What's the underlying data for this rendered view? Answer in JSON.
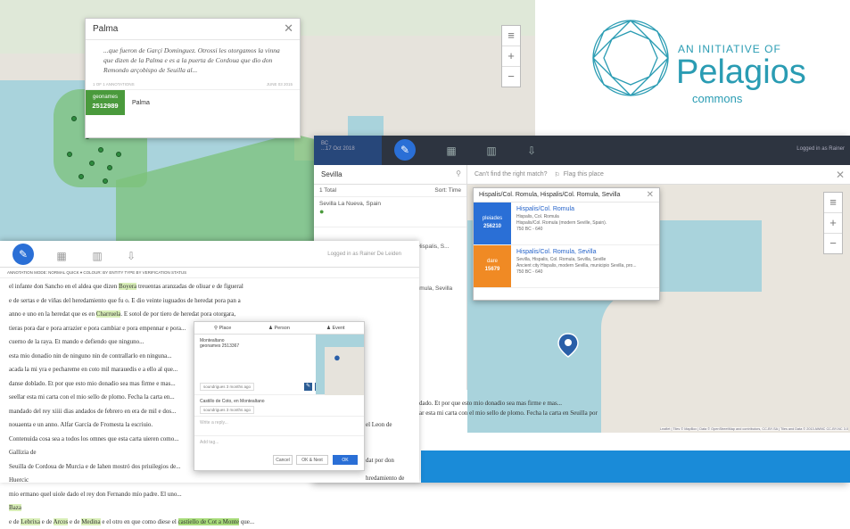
{
  "map1": {
    "zoom_in": "+",
    "zoom_out": "−",
    "layers": "≡"
  },
  "popup1": {
    "title": "Palma",
    "quote": "...que fueron de Garçi Dominguez. Otrossi les otorgamos la vinna que dizen de la Palma e es a la puerta de Cordoua que dio don Remondo arçobispo de Seuilla al...",
    "annotation_count": "1 OF 1 ANNOTATIONS",
    "date": "JUNE 03 2015",
    "gazetteer_name": "geonames",
    "gazetteer_id": "2512989",
    "place_name": "Palma"
  },
  "logo": {
    "line1": "AN INITIATIVE OF",
    "line2": "Pelagios",
    "line3": "commons"
  },
  "app2": {
    "header_left": "ВС",
    "header_left_sub": "...17 Oct 2018",
    "login": "Logged in as Rainer",
    "search_value": "Sevilla",
    "cant_find": "Can't find the right match?",
    "flag": "Flag this place",
    "results_count": "1 Total",
    "sort_label": "Sort: Time",
    "result1": "Sevilla La Nueva, Spain",
    "result_partial1": "...Hispalis, S...",
    "result_partial2": "Romula, Sevilla",
    "popup_title": "Hispalis/Col. Romula, Hispalis/Col. Romula, Sevilla",
    "entries": [
      {
        "gaz": "pleiades",
        "id": "256210",
        "name": "Hispalis/Col. Romula",
        "l1": "Hispalis, Col. Romula",
        "l2": "Hispalis/Col. Romula (modern Seville, Spain).",
        "l3": "750 BC - 640",
        "color": "#2a6fd6"
      },
      {
        "gaz": "dare",
        "id": "15679",
        "name": "Hispalis/Col. Romula, Sevilla",
        "l1": "Sevilla, Hispalis, Col. Romula, Sevilla, Seville",
        "l2": "Ancient city Hispalis, modern Sevilla, municipio Sevilla, pro...",
        "l3": "750 BC - 640",
        "color": "#f08a24"
      }
    ],
    "attribution": "Leaflet | Tiles © MapBox | Data © OpenStreetMap and contributors, CC-BY-SA | Tiles and Data © 2013 AWMC CC-BY-NC 3.0"
  },
  "app3": {
    "login": "Logged in as Rainer De Leiden",
    "modes": "ANNOTATION MODE: NORMAL  QUICK ▾  COLOUR: BY ENTITY TYPE  BY VERIFICATION STATUS",
    "lines": [
      "el infante don Sancho en el aldea que dizen Boyera treuentas aranzadas de oliuar e de figueral",
      "e de sertas e de viñas del heredamiento que fu o. E dio veinte iuguados de heredat pora pan a",
      "anno e uno en la heredat que es en Charruela. E sotol de por tiero de heredat pora otorgara,",
      "tieras pora dar e pora arrazier e pora cambiar e pora empennar e pora...",
      "cuerno de la raya. Et mando e defiendo que ninguno...",
      "esta mio donadio nin de ninguno nin de contrallarlo en ninguna...",
      "acada la mi yra e pechareme en coto mil marauedis e a ello al que...",
      "danse doblado. Et por que esto mio donadio sea mas firme e mas...",
      "seellar esta mi carta con el mio sello de plomo. Fecha la carta en...",
      "mandado del rey xiiii dias andados de febrero en era de mil e dos...",
      "nouaenta e un anno. Alfar García de Fromesta la escriuio.",
      "Contenuida cosa sea a todos los omnes que esta carta uieren como...",
      "Gallizia de",
      "Seuilla de Cordoua de Murcia e de Iahen mostró dos priuilegios de...",
      "Huercic",
      "mio ermano quel uiole dado el rey don Fernando mío padre. El uno...",
      "Baza",
      "e de Lebrixa e de Arcos e de Medina e el otro en que como diese el castiello de Cot a Monte que..."
    ],
    "right_fragments": [
      "el Leon de",
      "dat por don",
      "hredamiento de"
    ],
    "annot": {
      "tab_place": "Place",
      "tab_person": "Person",
      "tab_event": "Event",
      "place_name": "Montealtano",
      "place_id": "geonames 2513367",
      "user1": "soundrigues 3 months ago",
      "comment": "Castillo de Coto, en Montealtano",
      "user2": "soundrigues 3 months ago",
      "reply_ph": "Write a reply...",
      "tag_ph": "Add tag...",
      "cancel": "Cancel",
      "ok_next": "OK & Next",
      "ok": "OK"
    }
  },
  "overtext": {
    "l1": "dado. Et por que esto mio donadio sea mas firme e mas...",
    "l2": "ar esta mi carta con el mio sello de plomo. Fecha la carta en Seuilla por"
  }
}
